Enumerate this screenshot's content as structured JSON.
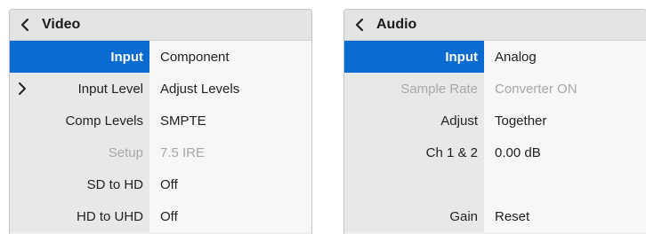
{
  "video": {
    "title": "Video",
    "back_icon": "chevron-left-icon",
    "rows": [
      {
        "label": "Input",
        "value": "Component",
        "state": "selected"
      },
      {
        "label": "Input Level",
        "value": "Adjust Levels",
        "state": "normal",
        "icon": "chevron-right-icon"
      },
      {
        "label": "Comp Levels",
        "value": "SMPTE",
        "state": "normal"
      },
      {
        "label": "Setup",
        "value": "7.5 IRE",
        "state": "disabled"
      },
      {
        "label": "SD to HD",
        "value": "Off",
        "state": "normal"
      },
      {
        "label": "HD to UHD",
        "value": "Off",
        "state": "normal"
      }
    ]
  },
  "audio": {
    "title": "Audio",
    "back_icon": "chevron-left-icon",
    "rows": [
      {
        "label": "Input",
        "value": "Analog",
        "state": "selected"
      },
      {
        "label": "Sample Rate",
        "value": "Converter ON",
        "state": "disabled"
      },
      {
        "label": "Adjust",
        "value": "Together",
        "state": "normal"
      },
      {
        "label": "Ch 1 & 2",
        "value": "0.00 dB",
        "state": "normal"
      },
      {
        "label": "Gain",
        "value": "Reset",
        "state": "normal"
      }
    ]
  },
  "colors": {
    "selected_bg": "#0a6bd1",
    "disabled_text": "#a8a8a8",
    "label_bg": "#e8e8e8",
    "value_bg": "#f7f7f7"
  }
}
